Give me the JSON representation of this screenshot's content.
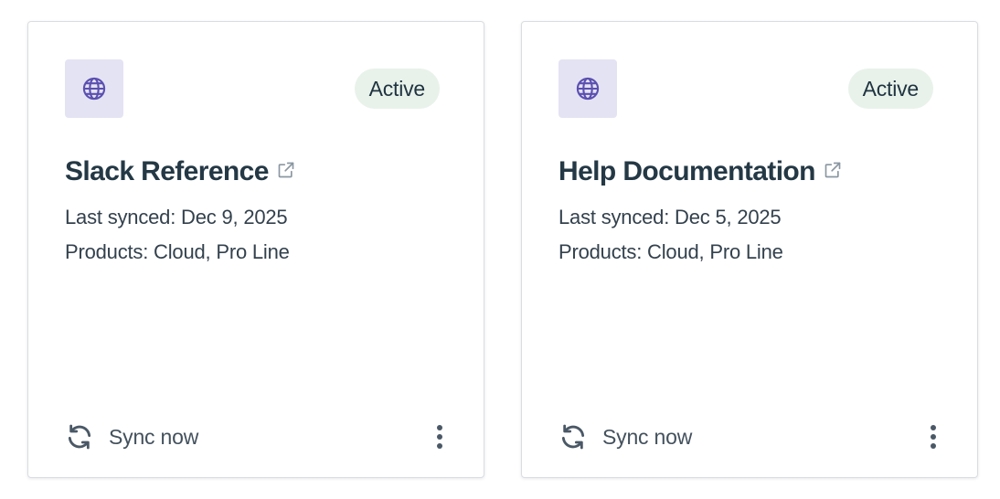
{
  "colors": {
    "icon_tile_bg": "#e4e3f3",
    "globe_icon": "#5b4fb0",
    "badge_bg": "#e8f2ea",
    "title_text": "#243845",
    "muted_icon": "#8a96a1"
  },
  "cards": [
    {
      "icon": "globe-icon",
      "status": "Active",
      "title": "Slack Reference",
      "title_link_icon": "external-link-icon",
      "last_synced": "Last synced: Dec 9, 2025",
      "products": "Products: Cloud, Pro Line",
      "sync_label": "Sync now",
      "sync_icon": "refresh-icon",
      "menu_icon": "more-vertical-icon"
    },
    {
      "icon": "globe-icon",
      "status": "Active",
      "title": "Help Documentation",
      "title_link_icon": "external-link-icon",
      "last_synced": "Last synced: Dec 5, 2025",
      "products": "Products: Cloud, Pro Line",
      "sync_label": "Sync now",
      "sync_icon": "refresh-icon",
      "menu_icon": "more-vertical-icon"
    }
  ]
}
